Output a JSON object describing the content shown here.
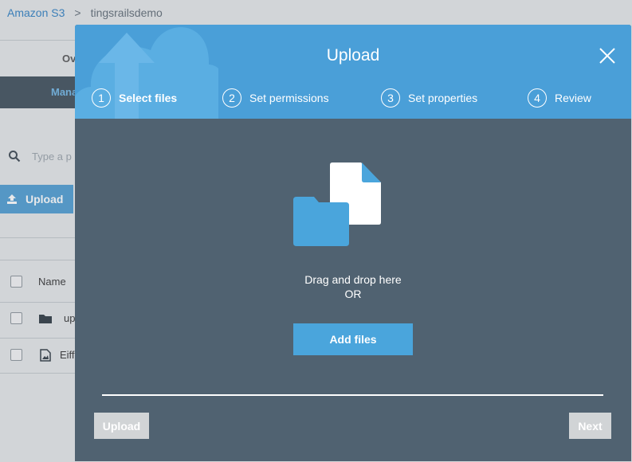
{
  "breadcrumb": {
    "root": "Amazon S3",
    "separator": ">",
    "bucket": "tingsrailsdemo"
  },
  "background": {
    "tab_overview": "Ov",
    "tab_manage": "Mana",
    "search_placeholder": "Type a p",
    "upload_button": "Upload",
    "column_name": "Name",
    "rows": [
      {
        "name": "up",
        "icon": "folder-icon"
      },
      {
        "name": "Eiff",
        "icon": "image-file-icon"
      }
    ]
  },
  "modal": {
    "title": "Upload",
    "steps": [
      {
        "num": "1",
        "label": "Select files",
        "active": true
      },
      {
        "num": "2",
        "label": "Set permissions",
        "active": false
      },
      {
        "num": "3",
        "label": "Set properties",
        "active": false
      },
      {
        "num": "4",
        "label": "Review",
        "active": false
      }
    ],
    "drop_line1": "Drag and drop here",
    "drop_line2": "OR",
    "add_files_label": "Add files",
    "upload_label": "Upload",
    "next_label": "Next"
  },
  "colors": {
    "header": "#4a9fd8",
    "body": "#506271",
    "accent": "#4aa5dc",
    "disabled": "#d1d4d6"
  }
}
